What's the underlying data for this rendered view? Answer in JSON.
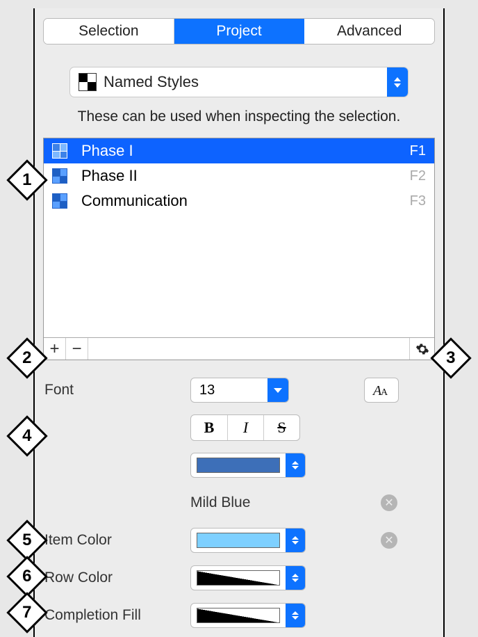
{
  "tabs": [
    "Selection",
    "Project",
    "Advanced"
  ],
  "selector": {
    "label": "Named Styles"
  },
  "hint": "These can be used when inspecting the selection.",
  "styles": [
    {
      "label": "Phase I",
      "shortcut": "F1",
      "selected": true
    },
    {
      "label": "Phase II",
      "shortcut": "F2",
      "selected": false
    },
    {
      "label": "Communication",
      "shortcut": "F3",
      "selected": false
    }
  ],
  "font": {
    "label": "Font",
    "size": "13"
  },
  "text_color": {
    "name": "Mild Blue",
    "swatch": "#3d6fb8"
  },
  "item_color": {
    "label": "Item Color",
    "swatch": "#7ed0ff"
  },
  "row_color": {
    "label": "Row Color"
  },
  "completion_fill": {
    "label": "Completion Fill"
  },
  "callouts": [
    "1",
    "2",
    "3",
    "4",
    "5",
    "6",
    "7"
  ]
}
